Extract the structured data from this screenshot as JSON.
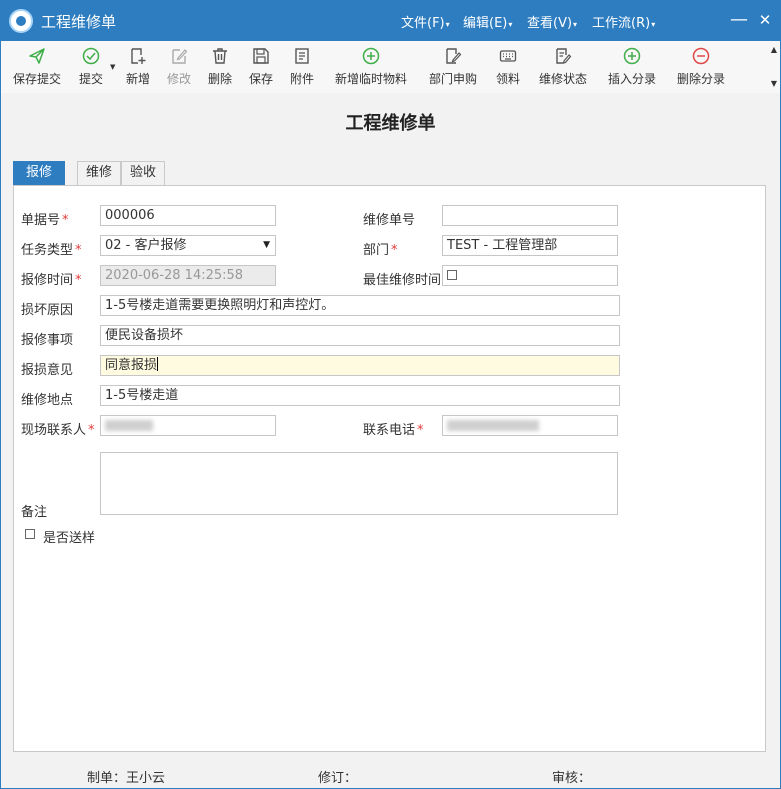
{
  "window": {
    "title": "工程维修单",
    "menus": [
      {
        "label": "文件(F)"
      },
      {
        "label": "编辑(E)"
      },
      {
        "label": "查看(V)"
      },
      {
        "label": "工作流(R)"
      }
    ],
    "minimize_symbol": "—",
    "close_symbol": "✕"
  },
  "toolbar": {
    "buttons": [
      {
        "label": "保存提交",
        "icon": "send-icon",
        "enabled": true
      },
      {
        "label": "提交",
        "icon": "check-circle-icon",
        "enabled": true
      },
      {
        "label": "新增",
        "icon": "add-document-icon",
        "enabled": true
      },
      {
        "label": "修改",
        "icon": "edit-icon",
        "enabled": false
      },
      {
        "label": "删除",
        "icon": "trash-icon",
        "enabled": true
      },
      {
        "label": "保存",
        "icon": "save-icon",
        "enabled": true
      },
      {
        "label": "附件",
        "icon": "attachment-document-icon",
        "enabled": true
      },
      {
        "label": "新增临时物料",
        "icon": "plus-circle-icon",
        "enabled": true
      },
      {
        "label": "部门申购",
        "icon": "purchase-request-icon",
        "enabled": true
      },
      {
        "label": "领料",
        "icon": "keyboard-icon",
        "enabled": true
      },
      {
        "label": "维修状态",
        "icon": "status-list-icon",
        "enabled": true
      },
      {
        "label": "插入分录",
        "icon": "plus-circle-icon",
        "enabled": true
      },
      {
        "label": "删除分录",
        "icon": "minus-circle-icon",
        "enabled": true
      }
    ],
    "colors": {
      "green": "#3fae49",
      "red": "#e04848",
      "gray": "#555555"
    }
  },
  "doc": {
    "title": "工程维修单"
  },
  "tabs": [
    {
      "label": "报修",
      "active": true
    },
    {
      "label": "维修",
      "active": false
    },
    {
      "label": "验收",
      "active": false
    }
  ],
  "form": {
    "bill_no": {
      "label": "单据号",
      "value": "000006",
      "required": true
    },
    "repair_no": {
      "label": "维修单号",
      "value": ""
    },
    "task_type": {
      "label": "任务类型",
      "value": "02 - 客户报修",
      "required": true
    },
    "department": {
      "label": "部门",
      "value": "TEST - 工程管理部",
      "required": true
    },
    "report_time": {
      "label": "报修时间",
      "value": "2020-06-28 14:25:58",
      "required": true
    },
    "best_time": {
      "label": "最佳维修时间",
      "checked": false
    },
    "damage_reason": {
      "label": "损坏原因",
      "value": "1-5号楼走道需要更换照明灯和声控灯。"
    },
    "repair_item": {
      "label": "报修事项",
      "value": "便民设备损坏"
    },
    "damage_opinion": {
      "label": "报损意见",
      "value": "同意报损"
    },
    "location": {
      "label": "维修地点",
      "value": "1-5号楼走道"
    },
    "contact": {
      "label": "现场联系人",
      "required": true
    },
    "phone": {
      "label": "联系电话",
      "required": true
    },
    "remarks": {
      "label": "备注",
      "value": ""
    },
    "send_sample": {
      "label": "是否送样",
      "checked": false
    }
  },
  "footer": {
    "creator": "制单：王小云",
    "revision": "修订：",
    "audit": "审核："
  },
  "colors": {
    "accent": "#2e7dc1",
    "required": "#e23b3b",
    "focus_bg": "#fffbe0"
  }
}
